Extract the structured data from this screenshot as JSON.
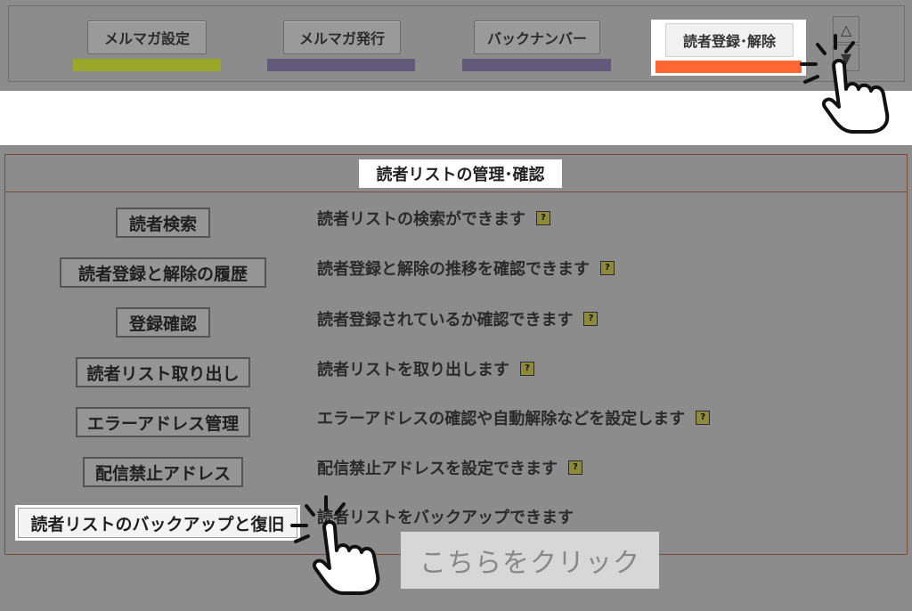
{
  "nav": {
    "tabs": [
      {
        "label": "メルマガ設定",
        "bar_color": "#9aa82a"
      },
      {
        "label": "メルマガ発行",
        "bar_color": "#615a7a"
      },
      {
        "label": "バックナンバー",
        "bar_color": "#615a7a"
      },
      {
        "label": "読者登録･解除",
        "bar_color": "#ff6633",
        "active": true
      }
    ],
    "scroll_up": "△",
    "scroll_down": "▼"
  },
  "section": {
    "title": "読者リストの管理･確認",
    "rows": [
      {
        "button": "読者検索",
        "description": "読者リストの検索ができます",
        "help": "?"
      },
      {
        "button": "読者登録と解除の履歴",
        "description": "読者登録と解除の推移を確認できます",
        "help": "?"
      },
      {
        "button": "登録確認",
        "description": "読者登録されているか確認できます",
        "help": "?"
      },
      {
        "button": "読者リスト取り出し",
        "description": "読者リストを取り出します",
        "help": "?"
      },
      {
        "button": "エラーアドレス管理",
        "description": "エラーアドレスの確認や自動解除などを設定します",
        "help": "?"
      },
      {
        "button": "配信禁止アドレス",
        "description": "配信禁止アドレスを設定できます",
        "help": "?"
      },
      {
        "button": "読者リストのバックアップと復旧",
        "description": "読者リストをバックアップできます"
      }
    ]
  },
  "callout": {
    "label": "こちらをクリック"
  },
  "colors": {
    "panel_bg": "#8c8c8c",
    "frame_border": "#7a4a40",
    "active_bar": "#ff6633"
  }
}
